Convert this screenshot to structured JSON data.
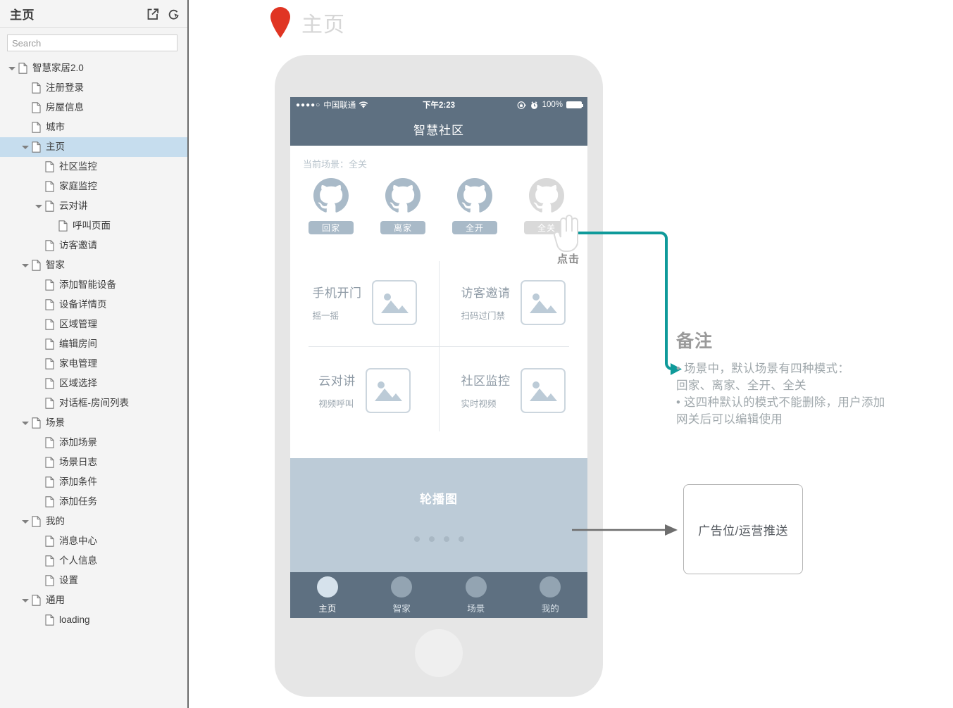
{
  "sidebar": {
    "title": "主页",
    "icons": [
      {
        "name": "export-icon"
      },
      {
        "name": "reload-cursor-icon"
      }
    ],
    "search_placeholder": "Search",
    "search_value": "",
    "tree": [
      {
        "label": "智慧家居2.0",
        "depth": 0,
        "twisty": true,
        "selected": false
      },
      {
        "label": "注册登录",
        "depth": 1,
        "twisty": false,
        "selected": false
      },
      {
        "label": "房屋信息",
        "depth": 1,
        "twisty": false,
        "selected": false
      },
      {
        "label": "城市",
        "depth": 1,
        "twisty": false,
        "selected": false
      },
      {
        "label": "主页",
        "depth": 1,
        "twisty": true,
        "selected": true
      },
      {
        "label": "社区监控",
        "depth": 2,
        "twisty": false,
        "selected": false
      },
      {
        "label": "家庭监控",
        "depth": 2,
        "twisty": false,
        "selected": false
      },
      {
        "label": "云对讲",
        "depth": 2,
        "twisty": true,
        "selected": false
      },
      {
        "label": "呼叫页面",
        "depth": 3,
        "twisty": false,
        "selected": false
      },
      {
        "label": "访客邀请",
        "depth": 2,
        "twisty": false,
        "selected": false
      },
      {
        "label": "智家",
        "depth": 1,
        "twisty": true,
        "selected": false
      },
      {
        "label": "添加智能设备",
        "depth": 2,
        "twisty": false,
        "selected": false
      },
      {
        "label": "设备详情页",
        "depth": 2,
        "twisty": false,
        "selected": false
      },
      {
        "label": "区域管理",
        "depth": 2,
        "twisty": false,
        "selected": false
      },
      {
        "label": "编辑房间",
        "depth": 2,
        "twisty": false,
        "selected": false
      },
      {
        "label": "家电管理",
        "depth": 2,
        "twisty": false,
        "selected": false
      },
      {
        "label": "区域选择",
        "depth": 2,
        "twisty": false,
        "selected": false
      },
      {
        "label": "对话框-房间列表",
        "depth": 2,
        "twisty": false,
        "selected": false
      },
      {
        "label": "场景",
        "depth": 1,
        "twisty": true,
        "selected": false
      },
      {
        "label": "添加场景",
        "depth": 2,
        "twisty": false,
        "selected": false
      },
      {
        "label": "场景日志",
        "depth": 2,
        "twisty": false,
        "selected": false
      },
      {
        "label": "添加条件",
        "depth": 2,
        "twisty": false,
        "selected": false
      },
      {
        "label": "添加任务",
        "depth": 2,
        "twisty": false,
        "selected": false
      },
      {
        "label": "我的",
        "depth": 1,
        "twisty": true,
        "selected": false
      },
      {
        "label": "消息中心",
        "depth": 2,
        "twisty": false,
        "selected": false
      },
      {
        "label": "个人信息",
        "depth": 2,
        "twisty": false,
        "selected": false
      },
      {
        "label": "设置",
        "depth": 2,
        "twisty": false,
        "selected": false
      },
      {
        "label": "通用",
        "depth": 1,
        "twisty": true,
        "selected": false
      },
      {
        "label": "loading",
        "depth": 2,
        "twisty": false,
        "selected": false
      }
    ]
  },
  "canvas": {
    "page_title": "主页",
    "pin_color": "#e03523"
  },
  "phone": {
    "status_bar": {
      "signal_dots": "●●●●○",
      "carrier": "中国联通",
      "wifi_icon": "wifi-icon",
      "time": "下午2:23",
      "rotation_lock_icon": "rotation-lock-icon",
      "alarm_icon": "alarm-clock-icon",
      "battery_percent": "100%"
    },
    "nav_title": "智慧社区",
    "scene": {
      "current_label": "当前场景：全关",
      "items": [
        {
          "label": "回家",
          "active": true
        },
        {
          "label": "离家",
          "active": true
        },
        {
          "label": "全开",
          "active": true
        },
        {
          "label": "全关",
          "active": false
        }
      ]
    },
    "features": [
      {
        "title": "手机开门",
        "sub": "摇一摇",
        "icon": "image-placeholder-icon"
      },
      {
        "title": "访客邀请",
        "sub": "扫码过门禁",
        "icon": "image-placeholder-icon"
      },
      {
        "title": "云对讲",
        "sub": "视频呼叫",
        "icon": "image-placeholder-icon"
      },
      {
        "title": "社区监控",
        "sub": "实时视频",
        "icon": "image-placeholder-icon"
      }
    ],
    "carousel": {
      "label": "轮播图",
      "dot_count": 4
    },
    "tabbar": [
      {
        "label": "主页",
        "active": true
      },
      {
        "label": "智家",
        "active": false
      },
      {
        "label": "场景",
        "active": false
      },
      {
        "label": "我的",
        "active": false
      }
    ]
  },
  "annotations": {
    "click_label": "点击",
    "note_title": "备注",
    "note_body": "• 场景中，默认场景有四种模式：\n回家、离家、全开、全关\n• 这四种默认的模式不能删除，用户添加\n网关后可以编辑使用",
    "ad_label": "广告位/运营推送",
    "connector_color": "#00a0a0",
    "arrow_color": "#6e6e6e"
  }
}
